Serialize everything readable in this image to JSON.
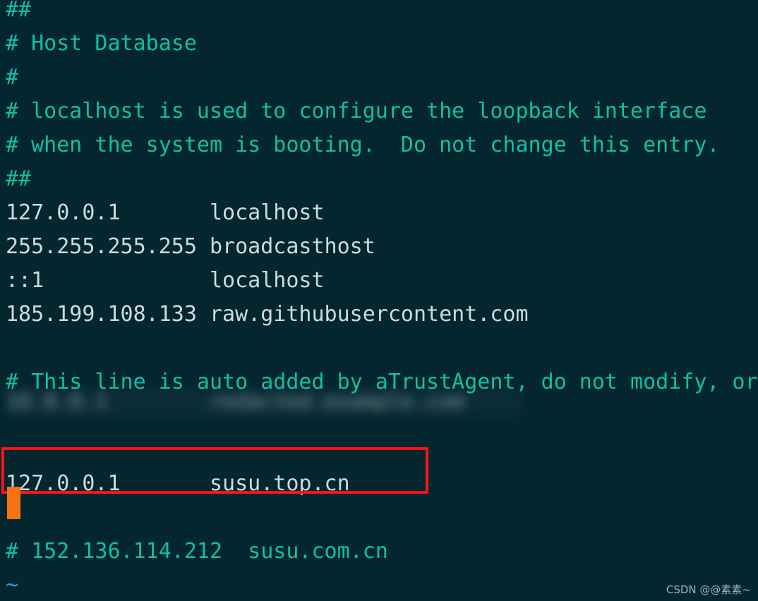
{
  "editor": {
    "app": "vim",
    "file": "hosts",
    "colors": {
      "background": "#04262f",
      "comment": "#0fbfa8",
      "entry_text": "#ccdbdd",
      "tilde": "#1f9fd6",
      "cursor": "#f97316",
      "highlight_box": "#ff1313",
      "watermark": "#9fb4b8"
    },
    "lines": [
      {
        "name": "line-hash-hash-top",
        "kind": "comment",
        "text": "##"
      },
      {
        "name": "line-host-database",
        "kind": "comment",
        "text": "# Host Database"
      },
      {
        "name": "line-hash-empty",
        "kind": "comment",
        "text": "#"
      },
      {
        "name": "line-localhost-used",
        "kind": "comment",
        "text": "# localhost is used to configure the loopback interface"
      },
      {
        "name": "line-when-booting",
        "kind": "comment",
        "text": "# when the system is booting.  Do not change this entry."
      },
      {
        "name": "line-hash-hash",
        "kind": "comment",
        "text": "##"
      },
      {
        "name": "line-entry-localhost-v4",
        "kind": "entry",
        "text": "127.0.0.1       localhost"
      },
      {
        "name": "line-entry-broadcast",
        "kind": "entry",
        "text": "255.255.255.255 broadcasthost"
      },
      {
        "name": "line-entry-localhost-v6",
        "kind": "entry",
        "text": "::1             localhost"
      },
      {
        "name": "line-entry-githubraw",
        "kind": "entry",
        "text": "185.199.108.133 raw.githubusercontent.com"
      },
      {
        "name": "line-blank-1",
        "kind": "blank",
        "text": " "
      },
      {
        "name": "line-atrustagent-note",
        "kind": "comment",
        "text": "# This line is auto added by aTrustAgent, do not modify, or"
      },
      {
        "name": "line-redacted",
        "kind": "redacted",
        "text": "10.0.0.1        redacted.example.com"
      },
      {
        "name": "line-blank-2",
        "kind": "blank",
        "text": " "
      },
      {
        "name": "line-entry-susu-top",
        "kind": "entry",
        "text": "127.0.0.1       susu.top.cn"
      },
      {
        "name": "line-cursor-row",
        "kind": "blank",
        "text": " "
      },
      {
        "name": "line-comment-susu-com",
        "kind": "comment",
        "text": "# 152.136.114.212  susu.com.cn"
      },
      {
        "name": "line-tilde-1",
        "kind": "tilde",
        "text": "~"
      }
    ],
    "highlight": {
      "label": "red-annotation-box",
      "target_line": "line-entry-susu-top"
    },
    "cursor": {
      "label": "block-cursor",
      "shape": "block"
    }
  },
  "watermark": {
    "text": "CSDN @@素素~"
  }
}
